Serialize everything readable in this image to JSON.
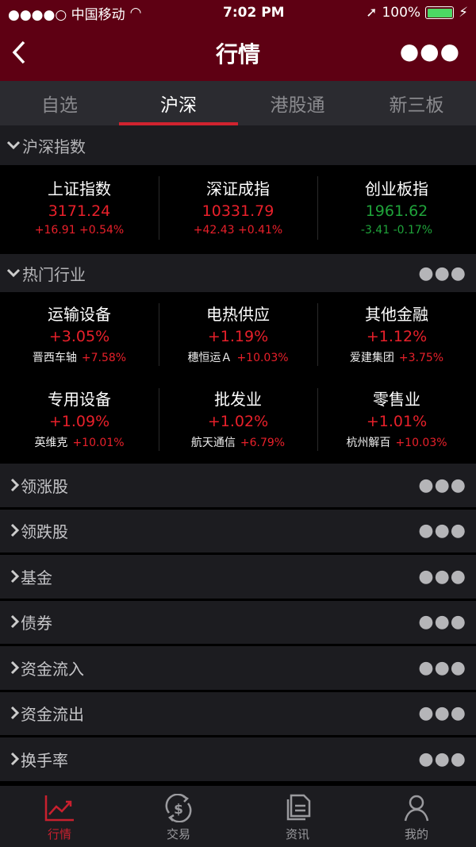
{
  "status": {
    "carrier": "●●●●○ 中国移动",
    "time": "7:02 PM",
    "battery": "100%",
    "battery_level": 100
  },
  "nav": {
    "title": "行情"
  },
  "tabs": [
    {
      "label": "自选"
    },
    {
      "label": "沪深",
      "active": true
    },
    {
      "label": "港股通"
    },
    {
      "label": "新三板"
    }
  ],
  "index_section": {
    "title": "沪深指数"
  },
  "indices": [
    {
      "name": "上证指数",
      "value": "3171.24",
      "change": "+16.91 +0.54%",
      "trend": "up"
    },
    {
      "name": "深证成指",
      "value": "10331.79",
      "change": "+42.43 +0.41%",
      "trend": "up"
    },
    {
      "name": "创业板指",
      "value": "1961.62",
      "change": "-3.41 -0.17%",
      "trend": "down"
    }
  ],
  "industry_section": {
    "title": "热门行业"
  },
  "industries": [
    {
      "name": "运输设备",
      "pct": "+3.05%",
      "stock": "晋西车轴",
      "stock_pct": "+7.58%"
    },
    {
      "name": "电热供应",
      "pct": "+1.19%",
      "stock": "穗恒运Ａ",
      "stock_pct": "+10.03%"
    },
    {
      "name": "其他金融",
      "pct": "+1.12%",
      "stock": "爱建集团",
      "stock_pct": "+3.75%"
    },
    {
      "name": "专用设备",
      "pct": "+1.09%",
      "stock": "英维克",
      "stock_pct": "+10.01%"
    },
    {
      "name": "批发业",
      "pct": "+1.02%",
      "stock": "航天通信",
      "stock_pct": "+6.79%"
    },
    {
      "name": "零售业",
      "pct": "+1.01%",
      "stock": "杭州解百",
      "stock_pct": "+10.03%"
    }
  ],
  "rows": [
    {
      "label": "领涨股"
    },
    {
      "label": "领跌股"
    },
    {
      "label": "基金"
    },
    {
      "label": "债券"
    },
    {
      "label": "资金流入"
    },
    {
      "label": "资金流出"
    },
    {
      "label": "换手率"
    }
  ],
  "tabbar": [
    {
      "label": "行情",
      "icon": "chart-trend-icon",
      "active": true
    },
    {
      "label": "交易",
      "icon": "dollar-exchange-icon"
    },
    {
      "label": "资讯",
      "icon": "documents-icon"
    },
    {
      "label": "我的",
      "icon": "user-icon"
    }
  ],
  "colors": {
    "brand": "#5e0013",
    "up": "#e8202a",
    "down": "#1fa33a",
    "accent": "#d0232f"
  }
}
